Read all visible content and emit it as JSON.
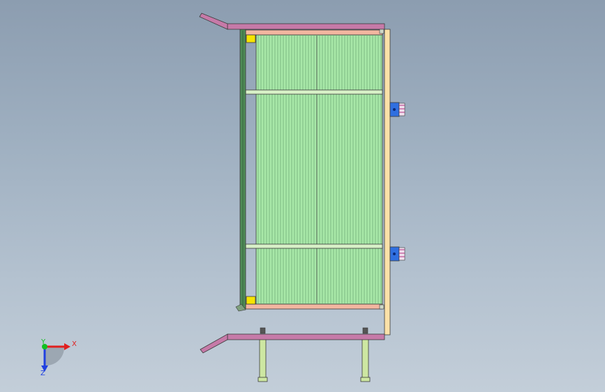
{
  "triad": {
    "x_label": "X",
    "y_label": "Y",
    "z_label": "Z",
    "x_color": "#e02020",
    "y_color": "#10c020",
    "z_color": "#2040e0"
  },
  "model": {
    "frame_color": "#c67aa8",
    "post_color": "#4f8b57",
    "slat_color": "#a8e8a8",
    "slat_line_color": "#6aa672",
    "crossbar_color": "#d7f0c7",
    "edge_color": "#f2b6a0",
    "side_panel_color": "#fbe1a8",
    "leg_color": "#cde7a2",
    "bracket_color": "#2f6fe0",
    "clip_color": "#f7e400"
  }
}
